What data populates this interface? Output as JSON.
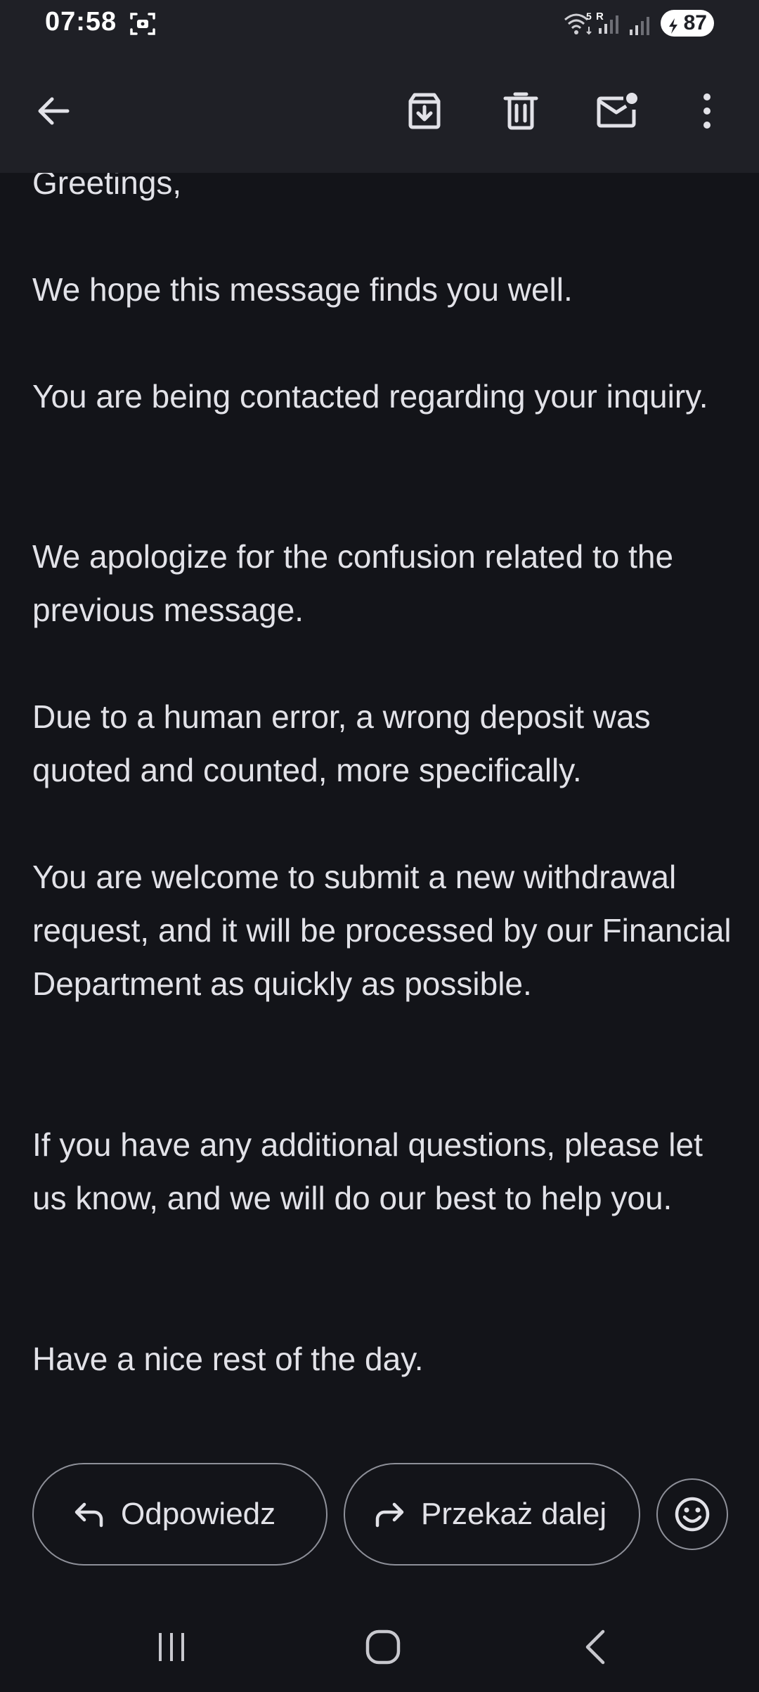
{
  "status_bar": {
    "time": "07:58",
    "battery_level": "87",
    "network_label": "5",
    "roaming_label": "R"
  },
  "toolbar": {
    "icons": [
      "back-arrow-icon",
      "archive-icon",
      "trash-icon",
      "mark-unread-icon",
      "more-vert-icon"
    ]
  },
  "email": {
    "paragraphs": [
      "Greetings,",
      "We hope this message finds you well.",
      "You are being contacted regarding your inquiry.",
      "We apologize for the confusion related to the previous message.",
      "Due to a human error, a wrong deposit was quoted and counted, more specifically.",
      "You are welcome to submit a new withdrawal request, and it will be processed by our Financial Department as quickly as possible.",
      "If you have any additional questions, please let us know, and we will do our best to help you.",
      "Have a nice rest of the day."
    ]
  },
  "actions": {
    "reply_label": "Odpowiedz",
    "forward_label": "Przekaż dalej"
  },
  "colors": {
    "background": "#131419",
    "toolbar": "#1f2026",
    "text": "#e2e2e8",
    "outline": "#8e9099"
  }
}
